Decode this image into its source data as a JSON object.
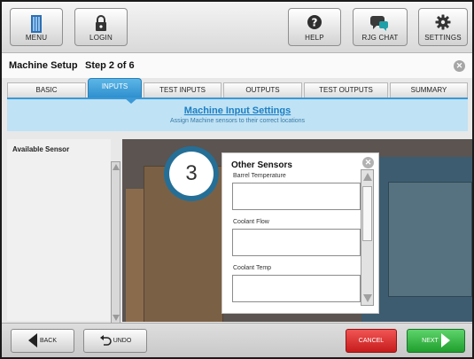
{
  "toolbar": {
    "menu": {
      "label": "MENU",
      "icon": "menu-icon"
    },
    "login": {
      "label": "LOGIN",
      "icon": "lock-icon"
    },
    "help": {
      "label": "HELP",
      "icon": "help-icon"
    },
    "chat": {
      "label": "RJG CHAT",
      "icon": "chat-icon"
    },
    "settings": {
      "label": "SETTINGS",
      "icon": "gear-icon"
    }
  },
  "header": {
    "title": "Machine Setup",
    "step": "Step 2 of 6"
  },
  "tabs": [
    {
      "label": "BASIC",
      "active": false
    },
    {
      "label": "INPUTS",
      "active": true
    },
    {
      "label": "TEST INPUTS",
      "active": false
    },
    {
      "label": "OUTPUTS",
      "active": false
    },
    {
      "label": "TEST OUTPUTS",
      "active": false
    },
    {
      "label": "SUMMARY",
      "active": false
    }
  ],
  "banner": {
    "heading": "Machine Input Settings",
    "subheading": "Assign Machine sensors to their correct locations"
  },
  "sidebar": {
    "heading": "Available Sensor"
  },
  "callout": {
    "number": "3"
  },
  "dialog": {
    "title": "Other Sensors",
    "fields": [
      {
        "label": "Barrel Temperature",
        "value": ""
      },
      {
        "label": "Coolant Flow",
        "value": ""
      },
      {
        "label": "Coolant Temp",
        "value": ""
      }
    ]
  },
  "footer": {
    "back": "BACK",
    "undo": "UNDO",
    "cancel": "CANCEL",
    "next": "NEXT"
  },
  "colors": {
    "accent": "#2f8fcf",
    "cancel": "#c61c1c",
    "next": "#1f9e2d",
    "callout": "#256f97"
  }
}
